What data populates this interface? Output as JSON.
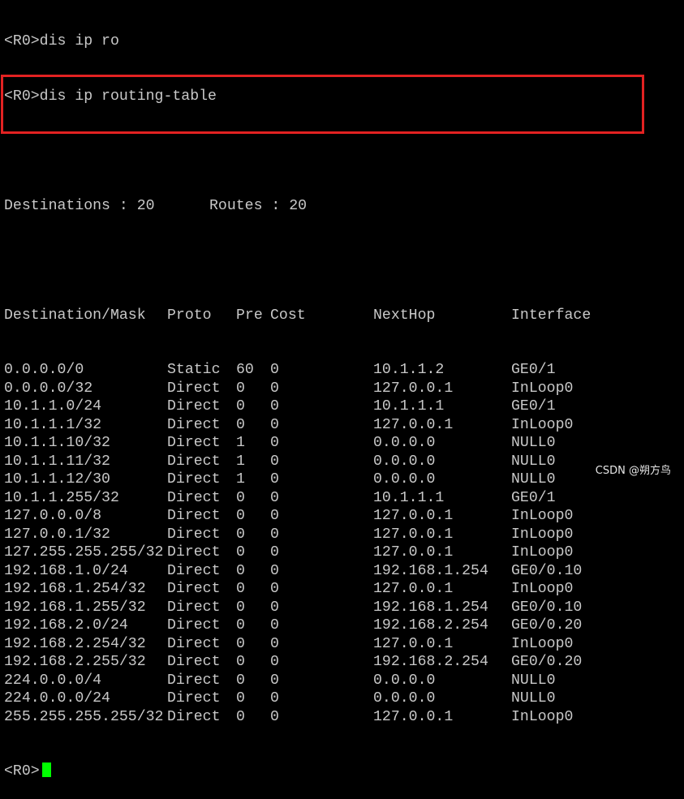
{
  "terminal": {
    "commands": [
      "<R0>dis ip ro",
      "<R0>dis ip routing-table"
    ],
    "summary": {
      "destinations_label": "Destinations : 20",
      "routes_label": "Routes : 20"
    },
    "headers": {
      "dest": "Destination/Mask",
      "proto": "Proto",
      "pre": "Pre",
      "cost": "Cost",
      "nexthop": "NextHop",
      "interface": "Interface"
    },
    "rows": [
      {
        "dest": "0.0.0.0/0",
        "proto": "Static",
        "pre": "60",
        "cost": "0",
        "nexthop": "10.1.1.2",
        "iface": "GE0/1"
      },
      {
        "dest": "0.0.0.0/32",
        "proto": "Direct",
        "pre": "0",
        "cost": "0",
        "nexthop": "127.0.0.1",
        "iface": "InLoop0"
      },
      {
        "dest": "10.1.1.0/24",
        "proto": "Direct",
        "pre": "0",
        "cost": "0",
        "nexthop": "10.1.1.1",
        "iface": "GE0/1"
      },
      {
        "dest": "10.1.1.1/32",
        "proto": "Direct",
        "pre": "0",
        "cost": "0",
        "nexthop": "127.0.0.1",
        "iface": "InLoop0"
      },
      {
        "dest": "10.1.1.10/32",
        "proto": "Direct",
        "pre": "1",
        "cost": "0",
        "nexthop": "0.0.0.0",
        "iface": "NULL0"
      },
      {
        "dest": "10.1.1.11/32",
        "proto": "Direct",
        "pre": "1",
        "cost": "0",
        "nexthop": "0.0.0.0",
        "iface": "NULL0"
      },
      {
        "dest": "10.1.1.12/30",
        "proto": "Direct",
        "pre": "1",
        "cost": "0",
        "nexthop": "0.0.0.0",
        "iface": "NULL0"
      },
      {
        "dest": "10.1.1.255/32",
        "proto": "Direct",
        "pre": "0",
        "cost": "0",
        "nexthop": "10.1.1.1",
        "iface": "GE0/1"
      },
      {
        "dest": "127.0.0.0/8",
        "proto": "Direct",
        "pre": "0",
        "cost": "0",
        "nexthop": "127.0.0.1",
        "iface": "InLoop0"
      },
      {
        "dest": "127.0.0.1/32",
        "proto": "Direct",
        "pre": "0",
        "cost": "0",
        "nexthop": "127.0.0.1",
        "iface": "InLoop0"
      },
      {
        "dest": "127.255.255.255/32",
        "proto": "Direct",
        "pre": "0",
        "cost": "0",
        "nexthop": "127.0.0.1",
        "iface": "InLoop0"
      },
      {
        "dest": "192.168.1.0/24",
        "proto": "Direct",
        "pre": "0",
        "cost": "0",
        "nexthop": "192.168.1.254",
        "iface": "GE0/0.10"
      },
      {
        "dest": "192.168.1.254/32",
        "proto": "Direct",
        "pre": "0",
        "cost": "0",
        "nexthop": "127.0.0.1",
        "iface": "InLoop0"
      },
      {
        "dest": "192.168.1.255/32",
        "proto": "Direct",
        "pre": "0",
        "cost": "0",
        "nexthop": "192.168.1.254",
        "iface": "GE0/0.10"
      },
      {
        "dest": "192.168.2.0/24",
        "proto": "Direct",
        "pre": "0",
        "cost": "0",
        "nexthop": "192.168.2.254",
        "iface": "GE0/0.20"
      },
      {
        "dest": "192.168.2.254/32",
        "proto": "Direct",
        "pre": "0",
        "cost": "0",
        "nexthop": "127.0.0.1",
        "iface": "InLoop0"
      },
      {
        "dest": "192.168.2.255/32",
        "proto": "Direct",
        "pre": "0",
        "cost": "0",
        "nexthop": "192.168.2.254",
        "iface": "GE0/0.20"
      },
      {
        "dest": "224.0.0.0/4",
        "proto": "Direct",
        "pre": "0",
        "cost": "0",
        "nexthop": "0.0.0.0",
        "iface": "NULL0"
      },
      {
        "dest": "224.0.0.0/24",
        "proto": "Direct",
        "pre": "0",
        "cost": "0",
        "nexthop": "0.0.0.0",
        "iface": "NULL0"
      },
      {
        "dest": "255.255.255.255/32",
        "proto": "Direct",
        "pre": "0",
        "cost": "0",
        "nexthop": "127.0.0.1",
        "iface": "InLoop0"
      }
    ],
    "prompt": "<R0>",
    "cursor_color": "#00ff00",
    "text_color": "#c8c8c8",
    "background": "#000000"
  },
  "annotation": {
    "highlight_color": "#e32222"
  },
  "watermark": "CSDN @朔方鸟"
}
